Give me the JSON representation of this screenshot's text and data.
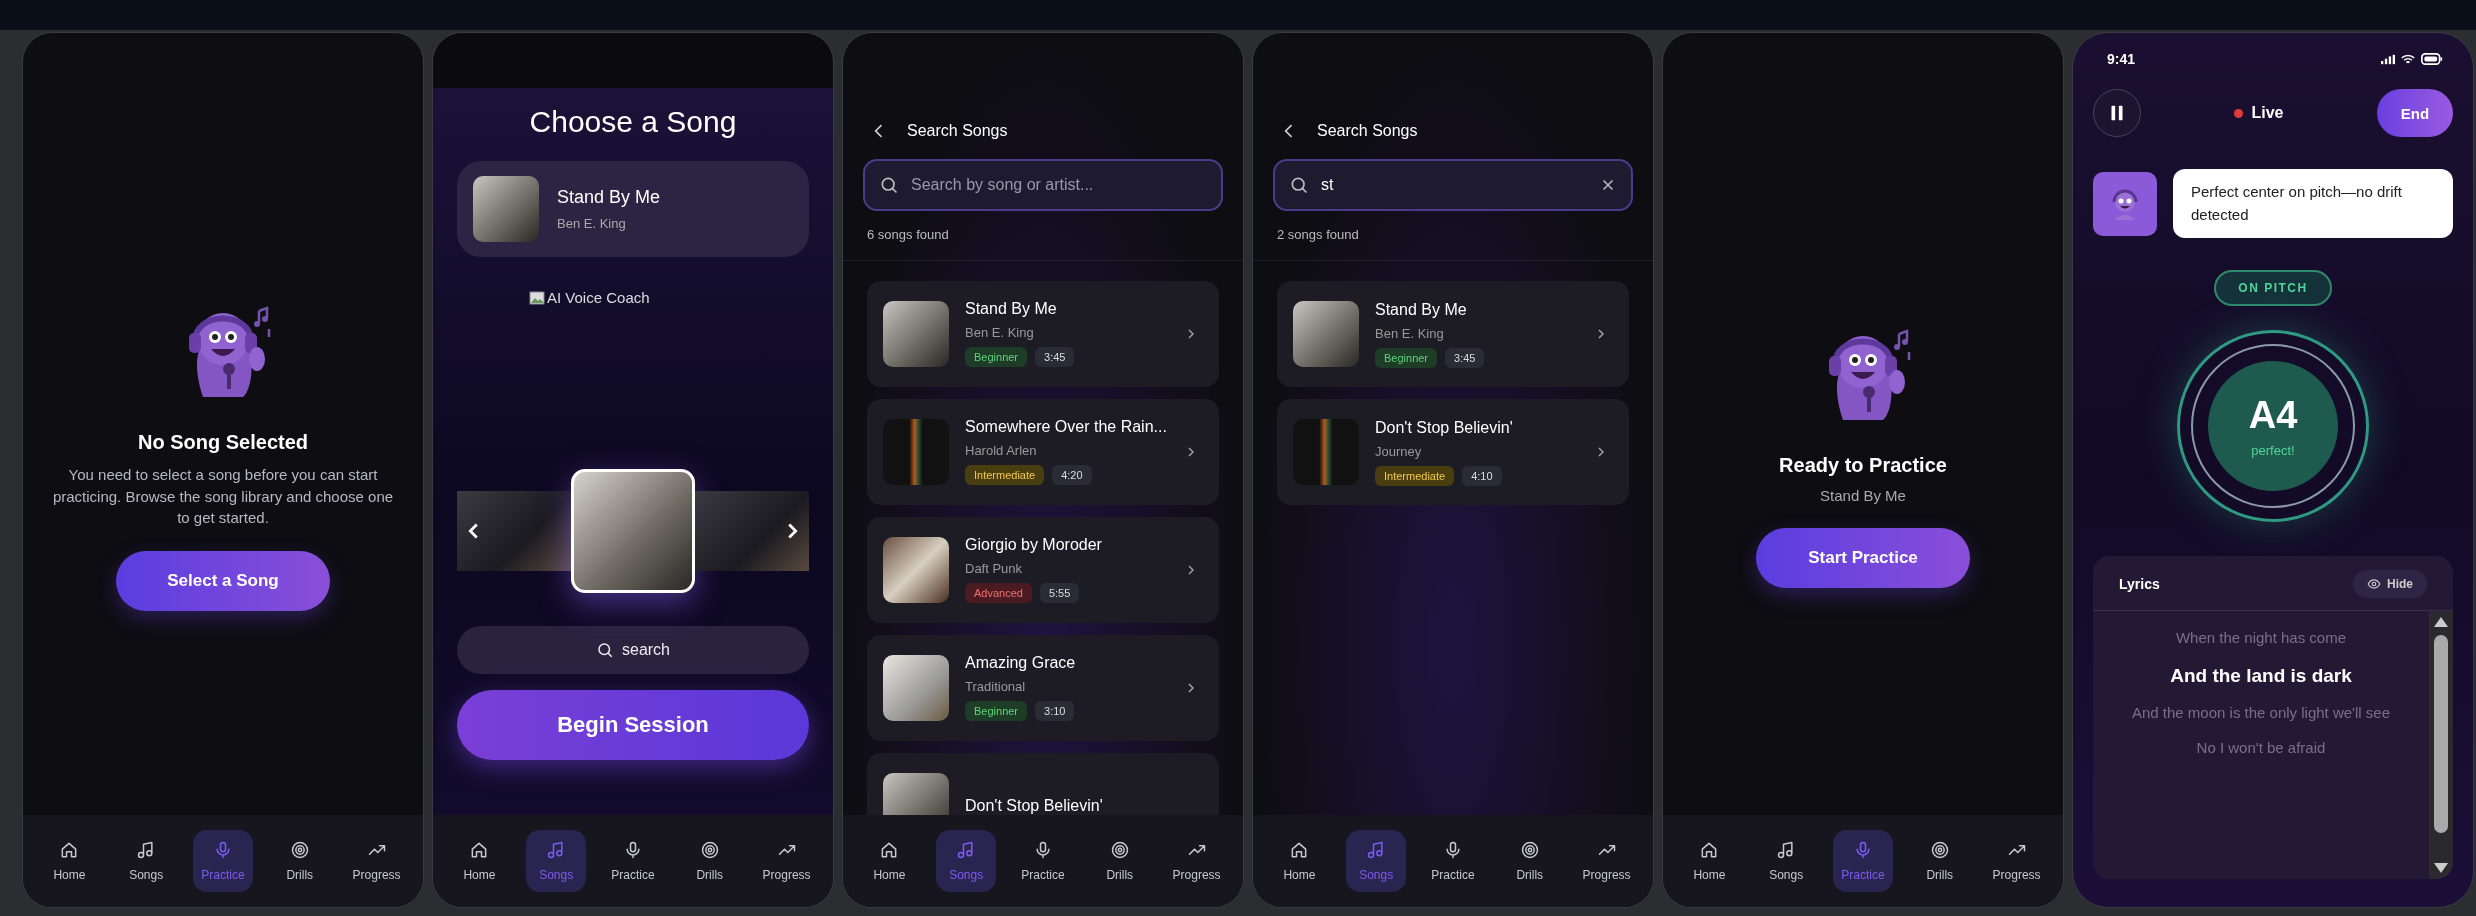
{
  "screens": [
    {
      "kind": "empty",
      "title": "No Song Selected",
      "message": "You need to select a song before you can start practicing. Browse the song library and choose one to get started.",
      "button": "Select a Song",
      "nav": [
        {
          "label": "Home",
          "kind": "home",
          "selected": false
        },
        {
          "label": "Songs",
          "kind": "songs",
          "selected": false
        },
        {
          "label": "Practice",
          "kind": "practice",
          "selected": true
        },
        {
          "label": "Drills",
          "kind": "drills",
          "selected": false
        },
        {
          "label": "Progress",
          "kind": "progress",
          "selected": false
        }
      ]
    },
    {
      "kind": "choose",
      "title": "Choose a Song",
      "current_song": {
        "title": "Stand By Me",
        "artist": "Ben E. King"
      },
      "image_alt": "AI Voice Coach",
      "carousel": [
        {
          "selected": false
        },
        {
          "selected": true
        },
        {
          "selected": false
        }
      ],
      "search_button": "search",
      "button": "Begin Session",
      "nav": [
        {
          "label": "Home",
          "kind": "home",
          "selected": false
        },
        {
          "label": "Songs",
          "kind": "songs",
          "selected": true
        },
        {
          "label": "Practice",
          "kind": "practice",
          "selected": false
        },
        {
          "label": "Drills",
          "kind": "drills",
          "selected": false
        },
        {
          "label": "Progress",
          "kind": "progress",
          "selected": false
        }
      ]
    },
    {
      "kind": "search",
      "title": "Search Songs",
      "search": {
        "placeholder": "Search by song or artist..."
      },
      "result_count": "6 songs found",
      "songs": [
        {
          "title": "Stand By Me",
          "artist": "Ben E. King",
          "difficulty": {
            "label": "Beginner",
            "kind": "beginner"
          },
          "duration": "3:45"
        },
        {
          "title": "Somewhere Over the Rain...",
          "artist": "Harold Arlen",
          "difficulty": {
            "label": "Intermediate",
            "kind": "intermediate"
          },
          "duration": "4:20"
        },
        {
          "title": "Giorgio by Moroder",
          "artist": "Daft Punk",
          "difficulty": {
            "label": "Advanced",
            "kind": "advanced"
          },
          "duration": "5:55"
        },
        {
          "title": "Amazing Grace",
          "artist": "Traditional",
          "difficulty": {
            "label": "Beginner",
            "kind": "beginner"
          },
          "duration": "3:10"
        },
        {
          "title": "Don't Stop Believin'"
        }
      ],
      "nav": [
        {
          "label": "Home",
          "kind": "home",
          "selected": false
        },
        {
          "label": "Songs",
          "kind": "songs",
          "selected": true
        },
        {
          "label": "Practice",
          "kind": "practice",
          "selected": false
        },
        {
          "label": "Drills",
          "kind": "drills",
          "selected": false
        },
        {
          "label": "Progress",
          "kind": "progress",
          "selected": false
        }
      ]
    },
    {
      "kind": "search",
      "title": "Search Songs",
      "search": {
        "value": "st"
      },
      "result_count": "2 songs found",
      "songs": [
        {
          "title": "Stand By Me",
          "artist": "Ben E. King",
          "difficulty": {
            "label": "Beginner",
            "kind": "beginner"
          },
          "duration": "3:45"
        },
        {
          "title": "Don't Stop Believin'",
          "artist": "Journey",
          "difficulty": {
            "label": "Intermediate",
            "kind": "intermediate"
          },
          "duration": "4:10"
        }
      ],
      "nav": [
        {
          "label": "Home",
          "kind": "home",
          "selected": false
        },
        {
          "label": "Songs",
          "kind": "songs",
          "selected": true
        },
        {
          "label": "Practice",
          "kind": "practice",
          "selected": false
        },
        {
          "label": "Drills",
          "kind": "drills",
          "selected": false
        },
        {
          "label": "Progress",
          "kind": "progress",
          "selected": false
        }
      ]
    },
    {
      "kind": "ready",
      "title": "Ready to Practice",
      "subtitle": "Stand By Me",
      "button": "Start Practice",
      "nav": [
        {
          "label": "Home",
          "kind": "home",
          "selected": false
        },
        {
          "label": "Songs",
          "kind": "songs",
          "selected": false
        },
        {
          "label": "Practice",
          "kind": "practice",
          "selected": true
        },
        {
          "label": "Drills",
          "kind": "drills",
          "selected": false
        },
        {
          "label": "Progress",
          "kind": "progress",
          "selected": false
        }
      ]
    },
    {
      "kind": "live",
      "status_time": "9:41",
      "live_label": "Live",
      "end_button": "End",
      "coach_message": "Perfect center on pitch—no drift detected",
      "pitch_status": "ON PITCH",
      "note": "A4",
      "note_feedback": "perfect!",
      "lyrics": {
        "title": "Lyrics",
        "hide_button": "Hide",
        "lines": [
          {
            "text": "When the night has come",
            "selected": false
          },
          {
            "text": "And the land is dark",
            "selected": true
          },
          {
            "text": "And the moon is the only light we'll see",
            "selected": false
          },
          {
            "text": "No I won't be afraid",
            "selected": false
          }
        ]
      }
    }
  ]
}
